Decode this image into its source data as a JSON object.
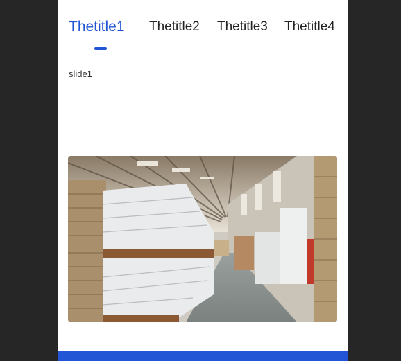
{
  "tabs": [
    {
      "label": "Thetitle1",
      "active": true
    },
    {
      "label": "Thetitle2",
      "active": false
    },
    {
      "label": "Thetitle3",
      "active": false
    },
    {
      "label": "Thetitle4",
      "active": false
    }
  ],
  "slide": {
    "label": "slide1",
    "image": "warehouse-photo"
  },
  "colors": {
    "accent": "#2255d6",
    "background": "#262626",
    "surface": "#ffffff"
  }
}
